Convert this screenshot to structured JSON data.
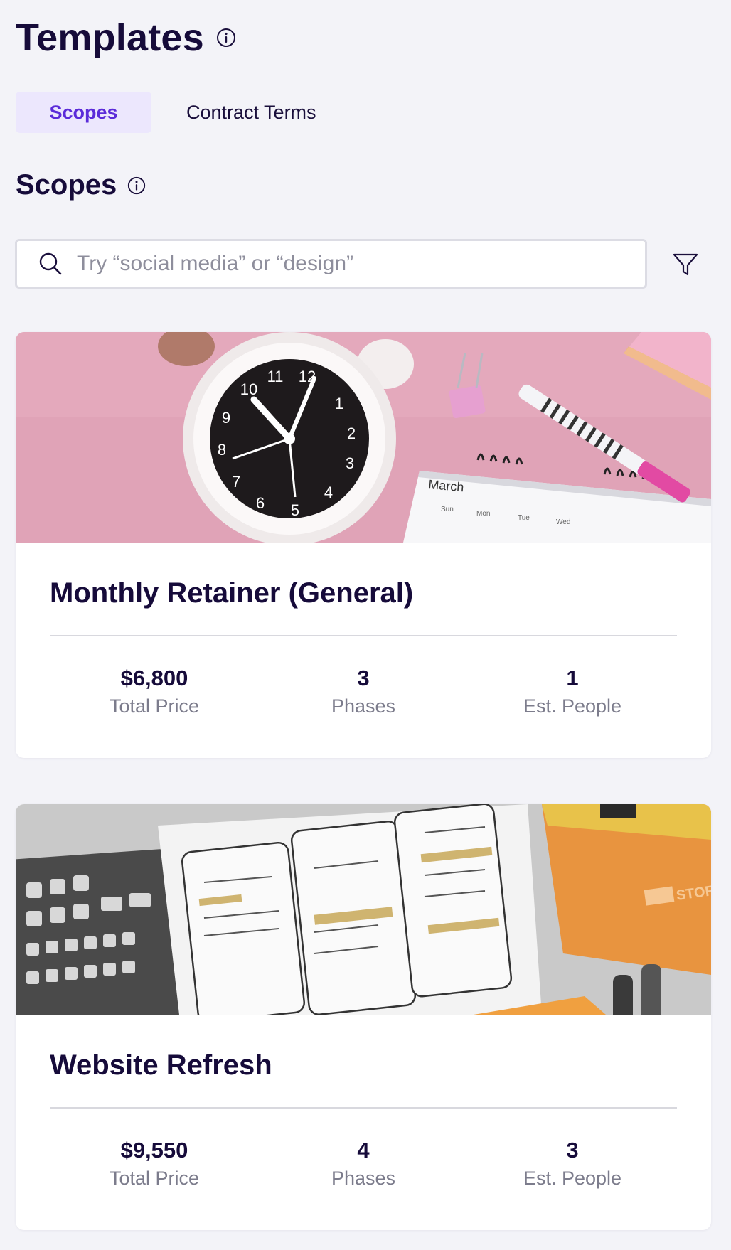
{
  "header": {
    "title": "Templates",
    "info_icon": "info-circle-icon"
  },
  "tabs": [
    {
      "label": "Scopes",
      "active": true
    },
    {
      "label": "Contract Terms",
      "active": false
    }
  ],
  "section": {
    "title": "Scopes",
    "info_icon": "info-circle-icon"
  },
  "search": {
    "placeholder": "Try “social media” or “design”",
    "value": "",
    "icon": "search-icon"
  },
  "filter": {
    "icon": "filter-icon"
  },
  "colors": {
    "accent": "#5b2bd9",
    "accent_bg": "#ece7fd",
    "title_text": "#160b3a",
    "muted_text": "#7c7c8c",
    "page_bg": "#f3f3f8"
  },
  "cards": [
    {
      "title": "Monthly Retainer (General)",
      "image": "alarm-clock-calendar-photo",
      "stats": [
        {
          "value": "$6,800",
          "label": "Total Price"
        },
        {
          "value": "3",
          "label": "Phases"
        },
        {
          "value": "1",
          "label": "Est. People"
        }
      ]
    },
    {
      "title": "Website Refresh",
      "image": "wireframe-sketches-photo",
      "stats": [
        {
          "value": "$9,550",
          "label": "Total Price"
        },
        {
          "value": "4",
          "label": "Phases"
        },
        {
          "value": "3",
          "label": "Est. People"
        }
      ]
    }
  ]
}
